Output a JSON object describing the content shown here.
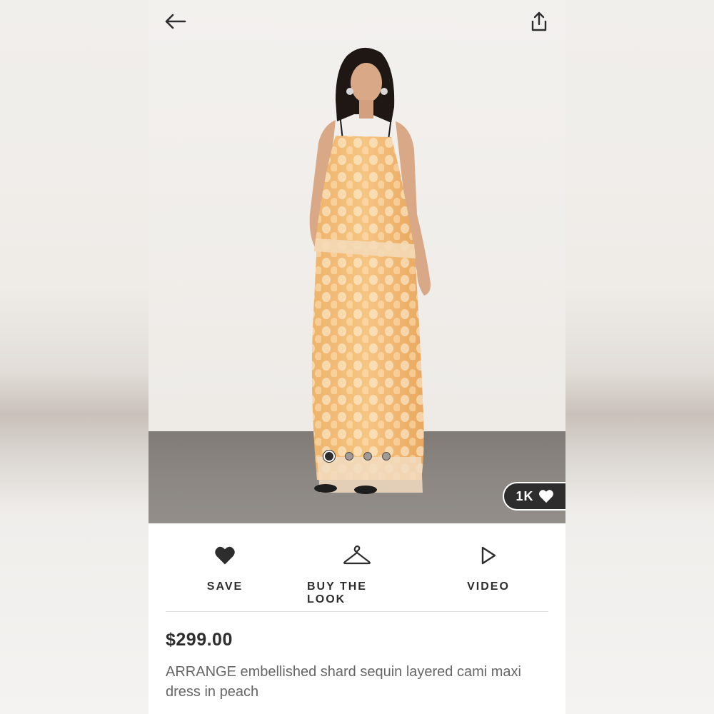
{
  "product": {
    "image_alt": "Model wearing peach sequin layered cami maxi dress",
    "dress_color": "#f0b46a",
    "gallery_count": 4,
    "gallery_active_index": 0,
    "likes_label": "1K",
    "price": "$299.00",
    "title": "ARRANGE embellished shard sequin layered cami maxi dress in peach"
  },
  "actions": {
    "save_label": "SAVE",
    "buy_look_label": "BUY THE LOOK",
    "video_label": "VIDEO"
  },
  "icons": {
    "back": "arrow-left-icon",
    "share": "share-icon",
    "save": "heart-icon",
    "buy_look": "hanger-icon",
    "video": "play-icon",
    "likes": "heart-icon"
  },
  "colors": {
    "text_dark": "#2d2d2d",
    "text_muted": "#666666",
    "pill_bg": "#2d2d2d"
  }
}
